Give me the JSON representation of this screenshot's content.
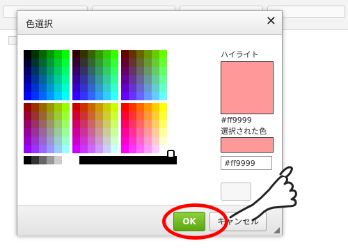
{
  "dialog": {
    "title": "色選択",
    "close_icon": "close-icon",
    "preview_label": "ハイライト",
    "preview_hex": "#ff9999",
    "selected_label": "選択された色",
    "hex_input_value": "#ff9999",
    "ok_label": "OK",
    "cancel_label": "キャンセル",
    "preview_color": "#ff9999",
    "selected_color": "#ff9999"
  },
  "annotations": {
    "highlight_ring_color": "#ff0000",
    "pointer_icon": "hand-pointer-icon"
  },
  "colors": {
    "ok_button": "#6cbd1f"
  }
}
